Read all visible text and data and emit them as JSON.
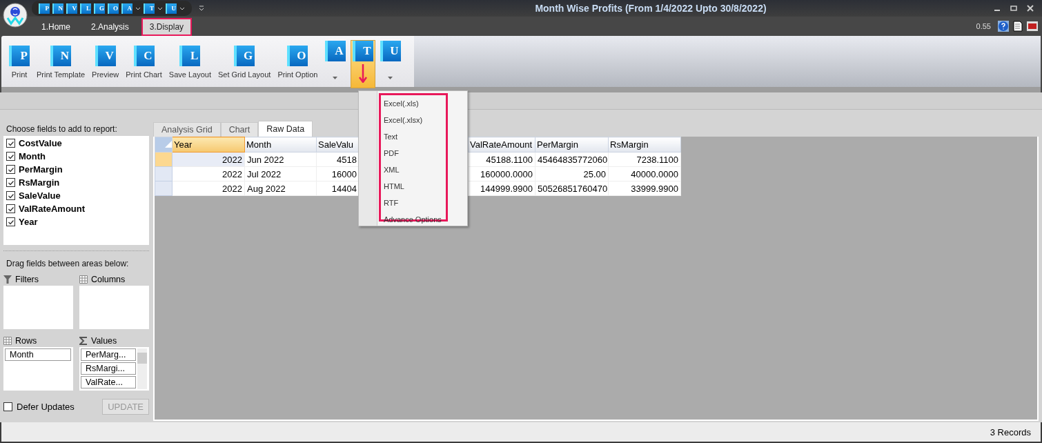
{
  "window": {
    "title": "Month Wise Profits (From 1/4/2022 Upto 30/8/2022)"
  },
  "quick_access": [
    {
      "kind": "button",
      "letter": "P"
    },
    {
      "kind": "button",
      "letter": "N"
    },
    {
      "kind": "button",
      "letter": "V"
    },
    {
      "kind": "button",
      "letter": "L"
    },
    {
      "kind": "button",
      "letter": "G"
    },
    {
      "kind": "button",
      "letter": "O"
    },
    {
      "kind": "dropdown",
      "letter": "A"
    },
    {
      "kind": "dropdown",
      "letter": "T"
    },
    {
      "kind": "dropdown",
      "letter": "U"
    }
  ],
  "ribbon_tabs": [
    {
      "label": "1.Home",
      "selected": false
    },
    {
      "label": "2.Analysis",
      "selected": false
    },
    {
      "label": "3.Display",
      "selected": true
    }
  ],
  "version": "0.55",
  "ribbon_buttons": [
    {
      "kind": "large",
      "letter": "P",
      "label": "Print"
    },
    {
      "kind": "large",
      "letter": "N",
      "label": "Print Template"
    },
    {
      "kind": "large",
      "letter": "V",
      "label": "Preview"
    },
    {
      "kind": "large",
      "letter": "C",
      "label": "Print Chart"
    },
    {
      "kind": "large",
      "letter": "L",
      "label": "Save Layout"
    },
    {
      "kind": "large",
      "letter": "G",
      "label": "Set Grid Layout"
    },
    {
      "kind": "large",
      "letter": "O",
      "label": "Print Option"
    },
    {
      "kind": "split",
      "letter": "A",
      "active": false
    },
    {
      "kind": "split",
      "letter": "T",
      "active": true
    },
    {
      "kind": "split",
      "letter": "U",
      "active": false
    }
  ],
  "export_menu": {
    "items": [
      "Excel(.xls)",
      "Excel(.xlsx)",
      "Text",
      "PDF",
      "XML",
      "HTML",
      "RTF",
      "Advance Options"
    ]
  },
  "field_list": {
    "title": "Choose fields to add to report:",
    "fields": [
      {
        "label": "CostValue",
        "checked": true
      },
      {
        "label": "Month",
        "checked": true
      },
      {
        "label": "PerMargin",
        "checked": true
      },
      {
        "label": "RsMargin",
        "checked": true
      },
      {
        "label": "SaleValue",
        "checked": true
      },
      {
        "label": "ValRateAmount",
        "checked": true
      },
      {
        "label": "Year",
        "checked": true
      }
    ],
    "drag_hint": "Drag fields between areas below:",
    "areas": {
      "filters": {
        "title": "Filters"
      },
      "columns": {
        "title": "Columns"
      },
      "rows": {
        "title": "Rows",
        "items": [
          "Month"
        ]
      },
      "values": {
        "title": "Values",
        "items": [
          "PerMarg...",
          "RsMargi...",
          "ValRate..."
        ]
      }
    },
    "defer_updates": {
      "label": "Defer Updates",
      "checked": false
    },
    "update_button": {
      "label": "UPDATE",
      "disabled": true
    }
  },
  "view_tabs": [
    {
      "label": "Analysis Grid",
      "selected": false
    },
    {
      "label": "Chart",
      "selected": false
    },
    {
      "label": "Raw Data",
      "selected": true
    }
  ],
  "table": {
    "columns": [
      {
        "label": "Year",
        "selected": true
      },
      {
        "label": "Month",
        "selected": false
      },
      {
        "label": "SaleValu",
        "selected": false
      },
      {
        "label": "ValRateAmount",
        "selected": false
      },
      {
        "label": "PerMargin",
        "selected": false
      },
      {
        "label": "RsMargin",
        "selected": false
      }
    ],
    "rows": [
      {
        "selected": true,
        "cells": [
          "2022",
          "Jun 2022",
          "4518",
          "45188.1100",
          "45464835772060",
          "7238.1100"
        ]
      },
      {
        "selected": false,
        "cells": [
          "2022",
          "Jul 2022",
          "16000",
          "160000.0000",
          "25.00",
          "40000.0000"
        ]
      },
      {
        "selected": false,
        "cells": [
          "2022",
          "Aug 2022",
          "14404",
          "144999.9900",
          "50526851760470",
          "33999.9900"
        ]
      }
    ]
  },
  "status_bar": {
    "records": "3 Records"
  }
}
